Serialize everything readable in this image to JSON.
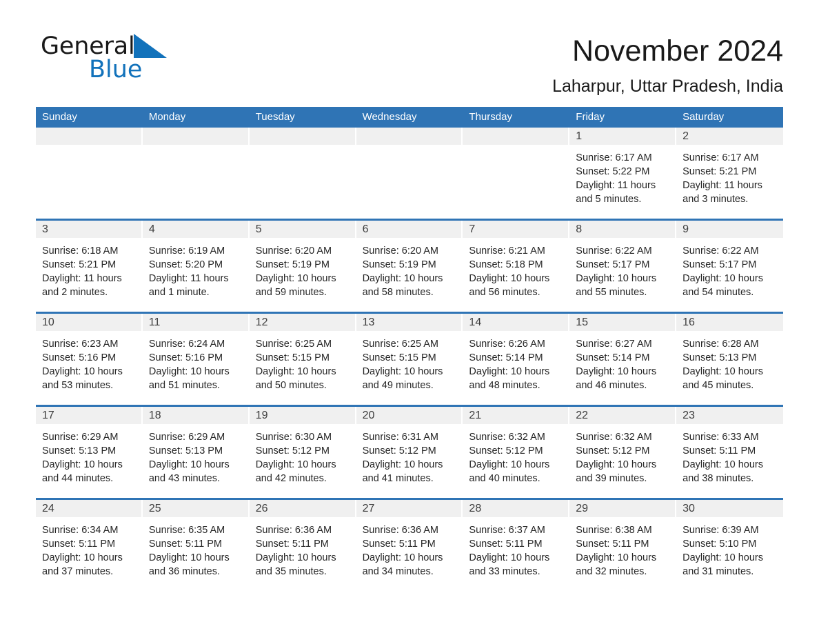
{
  "brand": {
    "name_part1": "General",
    "name_part2": "Blue",
    "triangle_color": "#1272bb"
  },
  "header": {
    "title": "November 2024",
    "location": "Laharpur, Uttar Pradesh, India"
  },
  "theme": {
    "header_blue": "#2f74b5",
    "day_band_gray": "#f0f0f0",
    "text_dark": "#262626"
  },
  "weekdays": [
    "Sunday",
    "Monday",
    "Tuesday",
    "Wednesday",
    "Thursday",
    "Friday",
    "Saturday"
  ],
  "weeks": [
    [
      {
        "day": "",
        "sunrise": "",
        "sunset": "",
        "daylight": "",
        "empty": true
      },
      {
        "day": "",
        "sunrise": "",
        "sunset": "",
        "daylight": "",
        "empty": true
      },
      {
        "day": "",
        "sunrise": "",
        "sunset": "",
        "daylight": "",
        "empty": true
      },
      {
        "day": "",
        "sunrise": "",
        "sunset": "",
        "daylight": "",
        "empty": true
      },
      {
        "day": "",
        "sunrise": "",
        "sunset": "",
        "daylight": "",
        "empty": true
      },
      {
        "day": "1",
        "sunrise": "Sunrise: 6:17 AM",
        "sunset": "Sunset: 5:22 PM",
        "daylight": "Daylight: 11 hours and 5 minutes.",
        "empty": false
      },
      {
        "day": "2",
        "sunrise": "Sunrise: 6:17 AM",
        "sunset": "Sunset: 5:21 PM",
        "daylight": "Daylight: 11 hours and 3 minutes.",
        "empty": false
      }
    ],
    [
      {
        "day": "3",
        "sunrise": "Sunrise: 6:18 AM",
        "sunset": "Sunset: 5:21 PM",
        "daylight": "Daylight: 11 hours and 2 minutes.",
        "empty": false
      },
      {
        "day": "4",
        "sunrise": "Sunrise: 6:19 AM",
        "sunset": "Sunset: 5:20 PM",
        "daylight": "Daylight: 11 hours and 1 minute.",
        "empty": false
      },
      {
        "day": "5",
        "sunrise": "Sunrise: 6:20 AM",
        "sunset": "Sunset: 5:19 PM",
        "daylight": "Daylight: 10 hours and 59 minutes.",
        "empty": false
      },
      {
        "day": "6",
        "sunrise": "Sunrise: 6:20 AM",
        "sunset": "Sunset: 5:19 PM",
        "daylight": "Daylight: 10 hours and 58 minutes.",
        "empty": false
      },
      {
        "day": "7",
        "sunrise": "Sunrise: 6:21 AM",
        "sunset": "Sunset: 5:18 PM",
        "daylight": "Daylight: 10 hours and 56 minutes.",
        "empty": false
      },
      {
        "day": "8",
        "sunrise": "Sunrise: 6:22 AM",
        "sunset": "Sunset: 5:17 PM",
        "daylight": "Daylight: 10 hours and 55 minutes.",
        "empty": false
      },
      {
        "day": "9",
        "sunrise": "Sunrise: 6:22 AM",
        "sunset": "Sunset: 5:17 PM",
        "daylight": "Daylight: 10 hours and 54 minutes.",
        "empty": false
      }
    ],
    [
      {
        "day": "10",
        "sunrise": "Sunrise: 6:23 AM",
        "sunset": "Sunset: 5:16 PM",
        "daylight": "Daylight: 10 hours and 53 minutes.",
        "empty": false
      },
      {
        "day": "11",
        "sunrise": "Sunrise: 6:24 AM",
        "sunset": "Sunset: 5:16 PM",
        "daylight": "Daylight: 10 hours and 51 minutes.",
        "empty": false
      },
      {
        "day": "12",
        "sunrise": "Sunrise: 6:25 AM",
        "sunset": "Sunset: 5:15 PM",
        "daylight": "Daylight: 10 hours and 50 minutes.",
        "empty": false
      },
      {
        "day": "13",
        "sunrise": "Sunrise: 6:25 AM",
        "sunset": "Sunset: 5:15 PM",
        "daylight": "Daylight: 10 hours and 49 minutes.",
        "empty": false
      },
      {
        "day": "14",
        "sunrise": "Sunrise: 6:26 AM",
        "sunset": "Sunset: 5:14 PM",
        "daylight": "Daylight: 10 hours and 48 minutes.",
        "empty": false
      },
      {
        "day": "15",
        "sunrise": "Sunrise: 6:27 AM",
        "sunset": "Sunset: 5:14 PM",
        "daylight": "Daylight: 10 hours and 46 minutes.",
        "empty": false
      },
      {
        "day": "16",
        "sunrise": "Sunrise: 6:28 AM",
        "sunset": "Sunset: 5:13 PM",
        "daylight": "Daylight: 10 hours and 45 minutes.",
        "empty": false
      }
    ],
    [
      {
        "day": "17",
        "sunrise": "Sunrise: 6:29 AM",
        "sunset": "Sunset: 5:13 PM",
        "daylight": "Daylight: 10 hours and 44 minutes.",
        "empty": false
      },
      {
        "day": "18",
        "sunrise": "Sunrise: 6:29 AM",
        "sunset": "Sunset: 5:13 PM",
        "daylight": "Daylight: 10 hours and 43 minutes.",
        "empty": false
      },
      {
        "day": "19",
        "sunrise": "Sunrise: 6:30 AM",
        "sunset": "Sunset: 5:12 PM",
        "daylight": "Daylight: 10 hours and 42 minutes.",
        "empty": false
      },
      {
        "day": "20",
        "sunrise": "Sunrise: 6:31 AM",
        "sunset": "Sunset: 5:12 PM",
        "daylight": "Daylight: 10 hours and 41 minutes.",
        "empty": false
      },
      {
        "day": "21",
        "sunrise": "Sunrise: 6:32 AM",
        "sunset": "Sunset: 5:12 PM",
        "daylight": "Daylight: 10 hours and 40 minutes.",
        "empty": false
      },
      {
        "day": "22",
        "sunrise": "Sunrise: 6:32 AM",
        "sunset": "Sunset: 5:12 PM",
        "daylight": "Daylight: 10 hours and 39 minutes.",
        "empty": false
      },
      {
        "day": "23",
        "sunrise": "Sunrise: 6:33 AM",
        "sunset": "Sunset: 5:11 PM",
        "daylight": "Daylight: 10 hours and 38 minutes.",
        "empty": false
      }
    ],
    [
      {
        "day": "24",
        "sunrise": "Sunrise: 6:34 AM",
        "sunset": "Sunset: 5:11 PM",
        "daylight": "Daylight: 10 hours and 37 minutes.",
        "empty": false
      },
      {
        "day": "25",
        "sunrise": "Sunrise: 6:35 AM",
        "sunset": "Sunset: 5:11 PM",
        "daylight": "Daylight: 10 hours and 36 minutes.",
        "empty": false
      },
      {
        "day": "26",
        "sunrise": "Sunrise: 6:36 AM",
        "sunset": "Sunset: 5:11 PM",
        "daylight": "Daylight: 10 hours and 35 minutes.",
        "empty": false
      },
      {
        "day": "27",
        "sunrise": "Sunrise: 6:36 AM",
        "sunset": "Sunset: 5:11 PM",
        "daylight": "Daylight: 10 hours and 34 minutes.",
        "empty": false
      },
      {
        "day": "28",
        "sunrise": "Sunrise: 6:37 AM",
        "sunset": "Sunset: 5:11 PM",
        "daylight": "Daylight: 10 hours and 33 minutes.",
        "empty": false
      },
      {
        "day": "29",
        "sunrise": "Sunrise: 6:38 AM",
        "sunset": "Sunset: 5:11 PM",
        "daylight": "Daylight: 10 hours and 32 minutes.",
        "empty": false
      },
      {
        "day": "30",
        "sunrise": "Sunrise: 6:39 AM",
        "sunset": "Sunset: 5:10 PM",
        "daylight": "Daylight: 10 hours and 31 minutes.",
        "empty": false
      }
    ]
  ]
}
